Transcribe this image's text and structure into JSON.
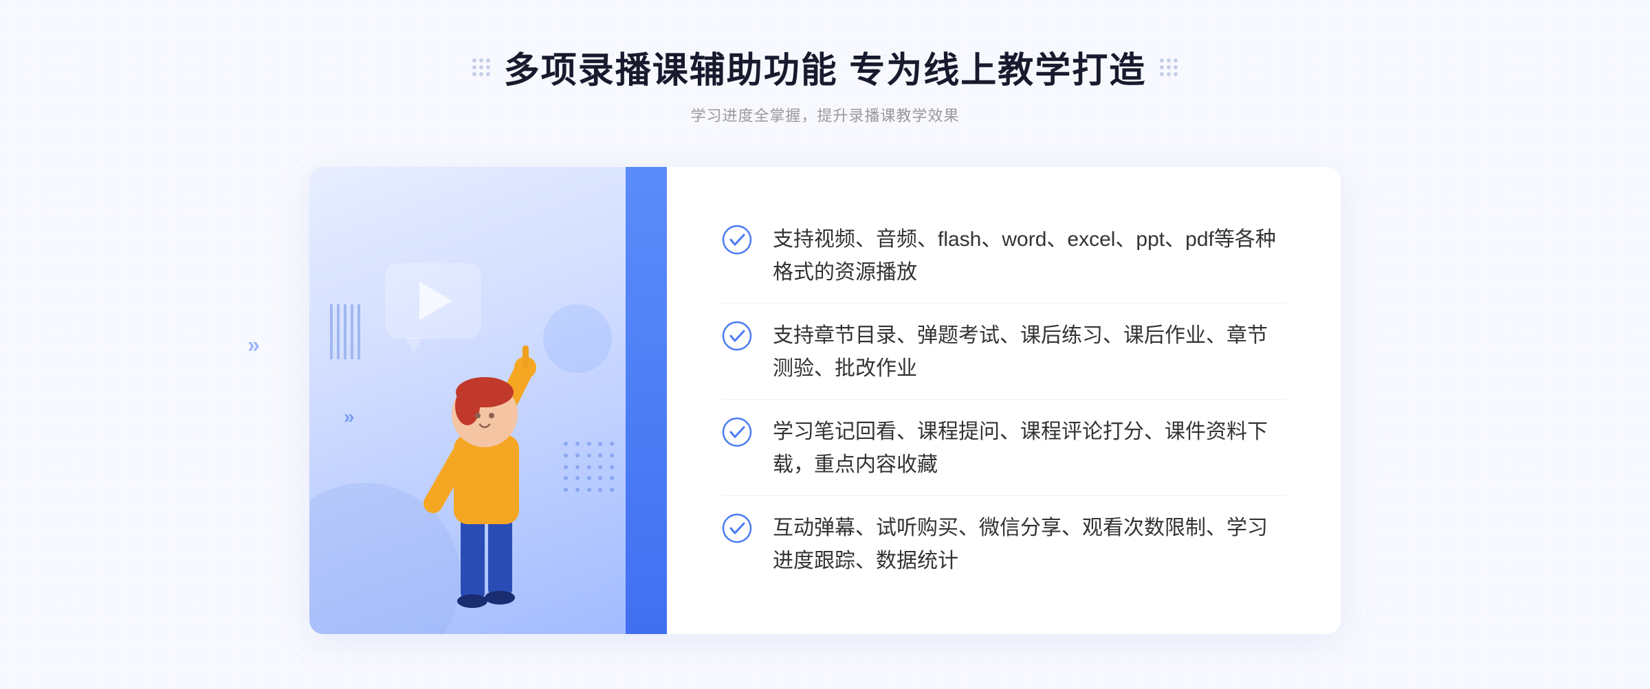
{
  "page": {
    "background_color": "#f8f9ff"
  },
  "header": {
    "title": "多项录播课辅助功能 专为线上教学打造",
    "subtitle": "学习进度全掌握，提升录播课教学效果"
  },
  "features": [
    {
      "id": 1,
      "text": "支持视频、音频、flash、word、excel、ppt、pdf等各种格式的资源播放"
    },
    {
      "id": 2,
      "text": "支持章节目录、弹题考试、课后练习、课后作业、章节测验、批改作业"
    },
    {
      "id": 3,
      "text": "学习笔记回看、课程提问、课程评论打分、课件资料下载，重点内容收藏"
    },
    {
      "id": 4,
      "text": "互动弹幕、试听购买、微信分享、观看次数限制、学习进度跟踪、数据统计"
    }
  ],
  "illustration": {
    "play_alt": "video play button"
  },
  "decorations": {
    "left_chevrons": "»",
    "outer_chevrons": "»"
  }
}
